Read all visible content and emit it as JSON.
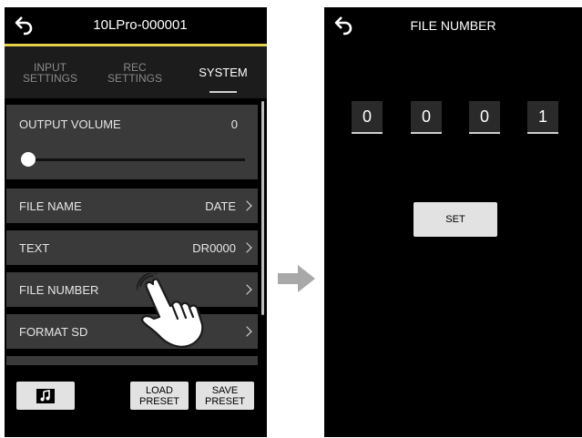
{
  "left_screen": {
    "header": {
      "title": "10LPro-000001",
      "back_icon": "back-arrow-icon"
    },
    "tabs": [
      {
        "label": "INPUT\nSETTINGS",
        "active": false
      },
      {
        "label": "REC\nSETTINGS",
        "active": false
      },
      {
        "label": "SYSTEM",
        "active": true
      }
    ],
    "items": [
      {
        "label": "OUTPUT VOLUME",
        "value": "0",
        "slider_level": 0
      },
      {
        "label": "FILE NAME",
        "value": "DATE"
      },
      {
        "label": "TEXT",
        "value": "DR0000"
      },
      {
        "label": "FILE NUMBER",
        "value": ""
      },
      {
        "label": "FORMAT SD",
        "value": ""
      }
    ],
    "footer": {
      "music_icon": "music-note-icon",
      "load_preset": "LOAD\nPRESET",
      "save_preset": "SAVE\nPRESET"
    }
  },
  "transition_icon": "right-arrow-icon",
  "right_screen": {
    "header": {
      "title": "FILE NUMBER",
      "back_icon": "back-arrow-icon"
    },
    "digits": [
      "0",
      "0",
      "0",
      "1"
    ],
    "set_button": "SET"
  },
  "colors": {
    "accent_line": "#e4d04c",
    "list_item_bg": "#3a3a3a",
    "background": "#000000"
  }
}
